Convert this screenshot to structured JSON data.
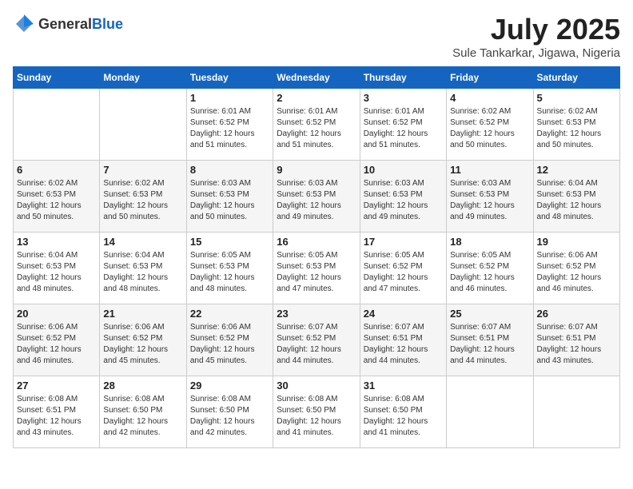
{
  "header": {
    "logo_general": "General",
    "logo_blue": "Blue",
    "month": "July 2025",
    "location": "Sule Tankarkar, Jigawa, Nigeria"
  },
  "weekdays": [
    "Sunday",
    "Monday",
    "Tuesday",
    "Wednesday",
    "Thursday",
    "Friday",
    "Saturday"
  ],
  "weeks": [
    [
      {
        "day": "",
        "sunrise": "",
        "sunset": "",
        "daylight": ""
      },
      {
        "day": "",
        "sunrise": "",
        "sunset": "",
        "daylight": ""
      },
      {
        "day": "1",
        "sunrise": "Sunrise: 6:01 AM",
        "sunset": "Sunset: 6:52 PM",
        "daylight": "Daylight: 12 hours and 51 minutes."
      },
      {
        "day": "2",
        "sunrise": "Sunrise: 6:01 AM",
        "sunset": "Sunset: 6:52 PM",
        "daylight": "Daylight: 12 hours and 51 minutes."
      },
      {
        "day": "3",
        "sunrise": "Sunrise: 6:01 AM",
        "sunset": "Sunset: 6:52 PM",
        "daylight": "Daylight: 12 hours and 51 minutes."
      },
      {
        "day": "4",
        "sunrise": "Sunrise: 6:02 AM",
        "sunset": "Sunset: 6:52 PM",
        "daylight": "Daylight: 12 hours and 50 minutes."
      },
      {
        "day": "5",
        "sunrise": "Sunrise: 6:02 AM",
        "sunset": "Sunset: 6:53 PM",
        "daylight": "Daylight: 12 hours and 50 minutes."
      }
    ],
    [
      {
        "day": "6",
        "sunrise": "Sunrise: 6:02 AM",
        "sunset": "Sunset: 6:53 PM",
        "daylight": "Daylight: 12 hours and 50 minutes."
      },
      {
        "day": "7",
        "sunrise": "Sunrise: 6:02 AM",
        "sunset": "Sunset: 6:53 PM",
        "daylight": "Daylight: 12 hours and 50 minutes."
      },
      {
        "day": "8",
        "sunrise": "Sunrise: 6:03 AM",
        "sunset": "Sunset: 6:53 PM",
        "daylight": "Daylight: 12 hours and 50 minutes."
      },
      {
        "day": "9",
        "sunrise": "Sunrise: 6:03 AM",
        "sunset": "Sunset: 6:53 PM",
        "daylight": "Daylight: 12 hours and 49 minutes."
      },
      {
        "day": "10",
        "sunrise": "Sunrise: 6:03 AM",
        "sunset": "Sunset: 6:53 PM",
        "daylight": "Daylight: 12 hours and 49 minutes."
      },
      {
        "day": "11",
        "sunrise": "Sunrise: 6:03 AM",
        "sunset": "Sunset: 6:53 PM",
        "daylight": "Daylight: 12 hours and 49 minutes."
      },
      {
        "day": "12",
        "sunrise": "Sunrise: 6:04 AM",
        "sunset": "Sunset: 6:53 PM",
        "daylight": "Daylight: 12 hours and 48 minutes."
      }
    ],
    [
      {
        "day": "13",
        "sunrise": "Sunrise: 6:04 AM",
        "sunset": "Sunset: 6:53 PM",
        "daylight": "Daylight: 12 hours and 48 minutes."
      },
      {
        "day": "14",
        "sunrise": "Sunrise: 6:04 AM",
        "sunset": "Sunset: 6:53 PM",
        "daylight": "Daylight: 12 hours and 48 minutes."
      },
      {
        "day": "15",
        "sunrise": "Sunrise: 6:05 AM",
        "sunset": "Sunset: 6:53 PM",
        "daylight": "Daylight: 12 hours and 48 minutes."
      },
      {
        "day": "16",
        "sunrise": "Sunrise: 6:05 AM",
        "sunset": "Sunset: 6:53 PM",
        "daylight": "Daylight: 12 hours and 47 minutes."
      },
      {
        "day": "17",
        "sunrise": "Sunrise: 6:05 AM",
        "sunset": "Sunset: 6:52 PM",
        "daylight": "Daylight: 12 hours and 47 minutes."
      },
      {
        "day": "18",
        "sunrise": "Sunrise: 6:05 AM",
        "sunset": "Sunset: 6:52 PM",
        "daylight": "Daylight: 12 hours and 46 minutes."
      },
      {
        "day": "19",
        "sunrise": "Sunrise: 6:06 AM",
        "sunset": "Sunset: 6:52 PM",
        "daylight": "Daylight: 12 hours and 46 minutes."
      }
    ],
    [
      {
        "day": "20",
        "sunrise": "Sunrise: 6:06 AM",
        "sunset": "Sunset: 6:52 PM",
        "daylight": "Daylight: 12 hours and 46 minutes."
      },
      {
        "day": "21",
        "sunrise": "Sunrise: 6:06 AM",
        "sunset": "Sunset: 6:52 PM",
        "daylight": "Daylight: 12 hours and 45 minutes."
      },
      {
        "day": "22",
        "sunrise": "Sunrise: 6:06 AM",
        "sunset": "Sunset: 6:52 PM",
        "daylight": "Daylight: 12 hours and 45 minutes."
      },
      {
        "day": "23",
        "sunrise": "Sunrise: 6:07 AM",
        "sunset": "Sunset: 6:52 PM",
        "daylight": "Daylight: 12 hours and 44 minutes."
      },
      {
        "day": "24",
        "sunrise": "Sunrise: 6:07 AM",
        "sunset": "Sunset: 6:51 PM",
        "daylight": "Daylight: 12 hours and 44 minutes."
      },
      {
        "day": "25",
        "sunrise": "Sunrise: 6:07 AM",
        "sunset": "Sunset: 6:51 PM",
        "daylight": "Daylight: 12 hours and 44 minutes."
      },
      {
        "day": "26",
        "sunrise": "Sunrise: 6:07 AM",
        "sunset": "Sunset: 6:51 PM",
        "daylight": "Daylight: 12 hours and 43 minutes."
      }
    ],
    [
      {
        "day": "27",
        "sunrise": "Sunrise: 6:08 AM",
        "sunset": "Sunset: 6:51 PM",
        "daylight": "Daylight: 12 hours and 43 minutes."
      },
      {
        "day": "28",
        "sunrise": "Sunrise: 6:08 AM",
        "sunset": "Sunset: 6:50 PM",
        "daylight": "Daylight: 12 hours and 42 minutes."
      },
      {
        "day": "29",
        "sunrise": "Sunrise: 6:08 AM",
        "sunset": "Sunset: 6:50 PM",
        "daylight": "Daylight: 12 hours and 42 minutes."
      },
      {
        "day": "30",
        "sunrise": "Sunrise: 6:08 AM",
        "sunset": "Sunset: 6:50 PM",
        "daylight": "Daylight: 12 hours and 41 minutes."
      },
      {
        "day": "31",
        "sunrise": "Sunrise: 6:08 AM",
        "sunset": "Sunset: 6:50 PM",
        "daylight": "Daylight: 12 hours and 41 minutes."
      },
      {
        "day": "",
        "sunrise": "",
        "sunset": "",
        "daylight": ""
      },
      {
        "day": "",
        "sunrise": "",
        "sunset": "",
        "daylight": ""
      }
    ]
  ]
}
